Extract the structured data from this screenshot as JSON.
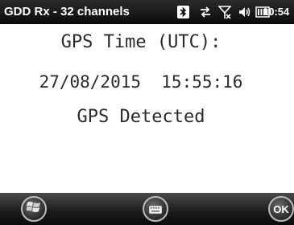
{
  "titlebar": {
    "app_title": "GDD Rx - 32 channels",
    "clock": "10:54",
    "icons": [
      "bluetooth-icon",
      "data-connection-icon",
      "no-signal-icon",
      "volume-icon",
      "battery-icon"
    ]
  },
  "content": {
    "gps_time_label": "GPS Time (UTC):",
    "gps_datetime": "27/08/2015  15:55:16",
    "gps_status": "GPS Detected"
  },
  "softkeys": {
    "ok_label": "OK",
    "icons": [
      "windows-start-icon",
      "keyboard-icon"
    ]
  },
  "colors": {
    "titlebar_bg": "#111111",
    "content_bg": "#ffffff",
    "text": "#2a2a2a"
  }
}
